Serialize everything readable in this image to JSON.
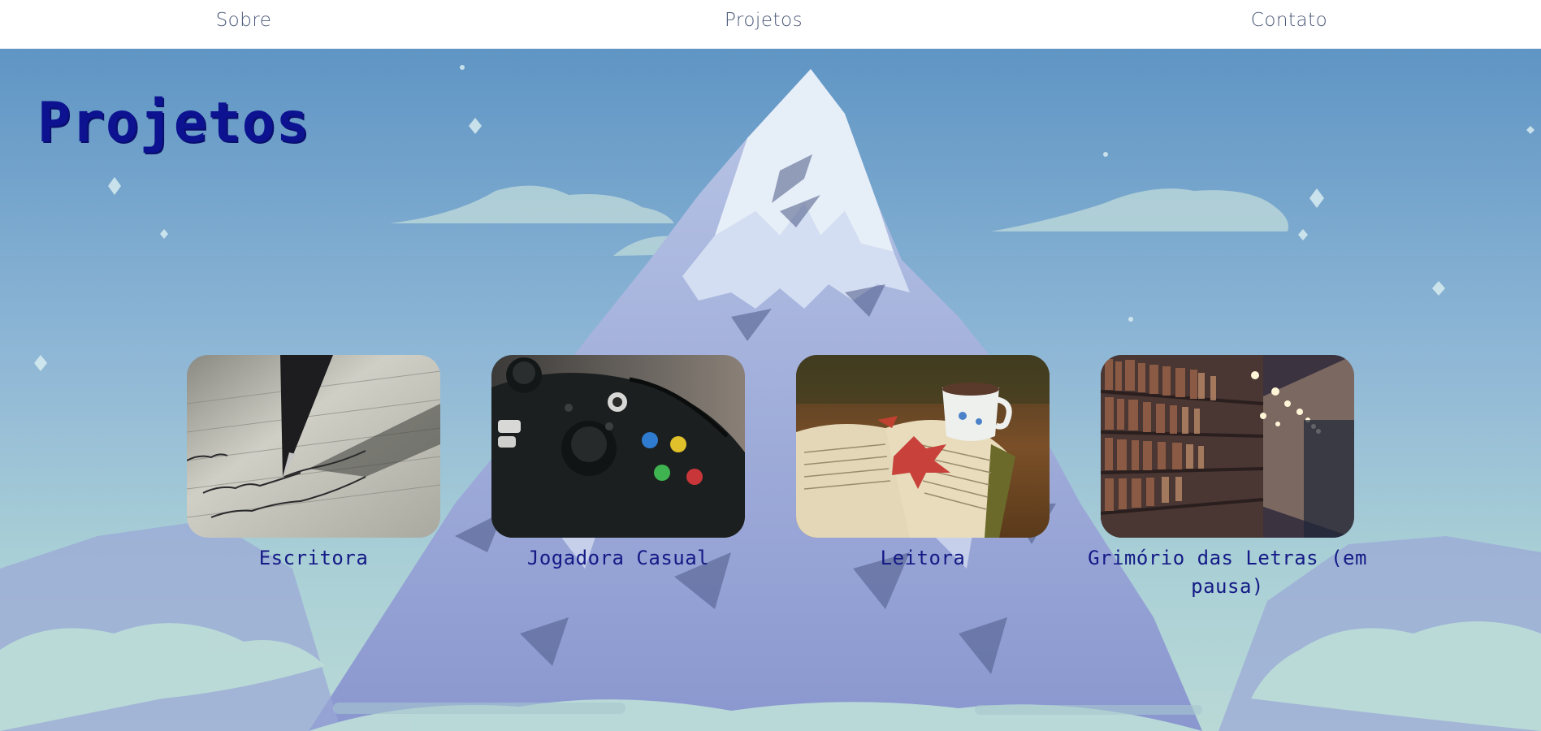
{
  "nav": {
    "sobre": "Sobre",
    "projetos": "Projetos",
    "contato": "Contato"
  },
  "page": {
    "title": "Projetos"
  },
  "projects": [
    {
      "caption": "Escritora",
      "image": "fountain-pen-writing-image"
    },
    {
      "caption": "Jogadora Casual",
      "image": "game-controller-image"
    },
    {
      "caption": "Leitora",
      "image": "open-book-with-tea-image"
    },
    {
      "caption": "Grimório das Letras (em pausa)",
      "image": "library-bookshelves-image"
    }
  ],
  "colors": {
    "nav_bg": "#ffffff",
    "nav_text": "#4a5878",
    "title": "#0c1290",
    "caption": "#141a86",
    "sky_top": "#5f95c4",
    "sky_bottom": "#a9cfd6"
  }
}
